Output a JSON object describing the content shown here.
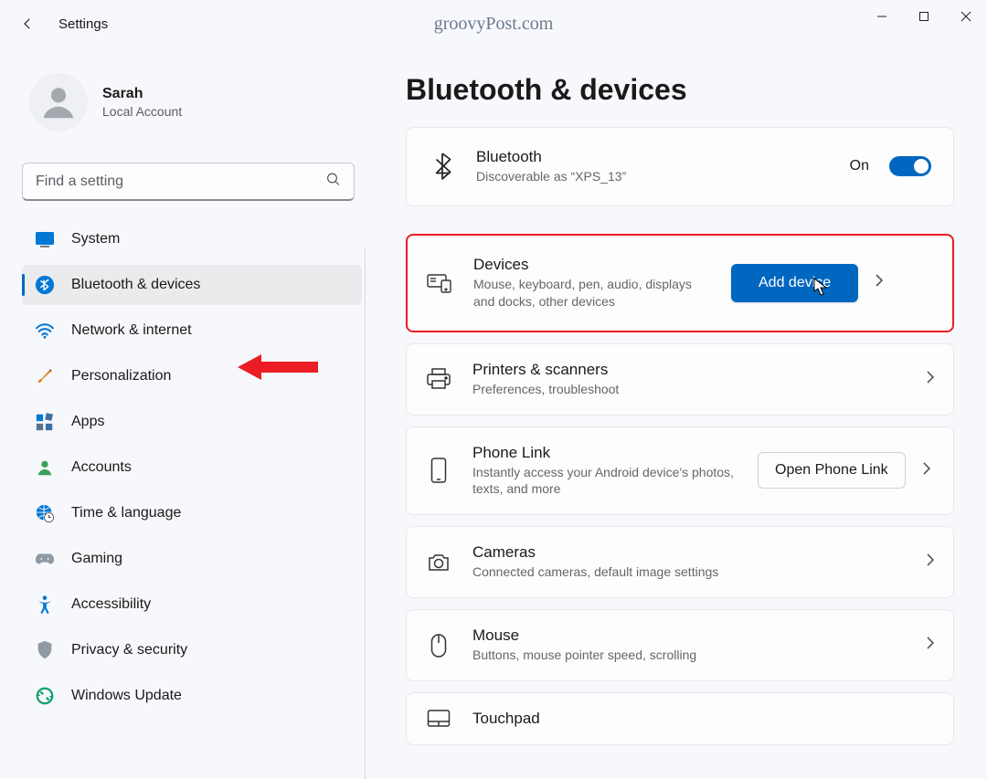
{
  "window": {
    "app_title": "Settings",
    "watermark": "groovyPost.com"
  },
  "profile": {
    "name": "Sarah",
    "sub": "Local Account"
  },
  "search": {
    "placeholder": "Find a setting"
  },
  "sidebar": {
    "items": [
      {
        "label": "System"
      },
      {
        "label": "Bluetooth & devices"
      },
      {
        "label": "Network & internet"
      },
      {
        "label": "Personalization"
      },
      {
        "label": "Apps"
      },
      {
        "label": "Accounts"
      },
      {
        "label": "Time & language"
      },
      {
        "label": "Gaming"
      },
      {
        "label": "Accessibility"
      },
      {
        "label": "Privacy & security"
      },
      {
        "label": "Windows Update"
      }
    ]
  },
  "page": {
    "title": "Bluetooth & devices",
    "bluetooth": {
      "title": "Bluetooth",
      "sub": "Discoverable as “XPS_13”",
      "toggle_state": "On"
    },
    "devices": {
      "title": "Devices",
      "sub": "Mouse, keyboard, pen, audio, displays and docks, other devices",
      "button": "Add device"
    },
    "printers": {
      "title": "Printers & scanners",
      "sub": "Preferences, troubleshoot"
    },
    "phone": {
      "title": "Phone Link",
      "sub": "Instantly access your Android device's photos, texts, and more",
      "button": "Open Phone Link"
    },
    "cameras": {
      "title": "Cameras",
      "sub": "Connected cameras, default image settings"
    },
    "mouse": {
      "title": "Mouse",
      "sub": "Buttons, mouse pointer speed, scrolling"
    },
    "touchpad": {
      "title": "Touchpad"
    }
  }
}
